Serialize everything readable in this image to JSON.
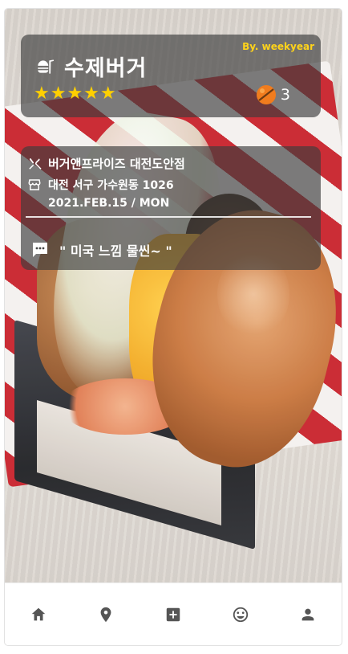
{
  "post": {
    "author": "By. weekyear",
    "title": "수제버거",
    "rating": 5,
    "rating_max": 5,
    "stars": "★★★★★",
    "count": "3",
    "title_icon": "burger-icon",
    "count_icon": "badge-ball-icon"
  },
  "info": {
    "place": "버거앤프라이즈 대전도안점",
    "address": "대전 서구 가수원동 1026",
    "date": "2021.FEB.15 / MON",
    "comment": "\" 미국 느낌 물씬~ \"",
    "place_icon": "utensils-icon",
    "address_icon": "store-icon",
    "comment_icon": "comment-icon"
  },
  "nav": {
    "items": [
      {
        "name": "home",
        "icon": "home-icon"
      },
      {
        "name": "map",
        "icon": "location-pin-icon"
      },
      {
        "name": "add",
        "icon": "add-square-icon"
      },
      {
        "name": "mood",
        "icon": "smile-icon"
      },
      {
        "name": "profile",
        "icon": "person-icon"
      }
    ]
  },
  "colors": {
    "accent_yellow": "#ffd31a",
    "star": "#ffd000",
    "card_bg": "rgba(60,60,60,0.66)",
    "nav_icon": "#555555"
  }
}
